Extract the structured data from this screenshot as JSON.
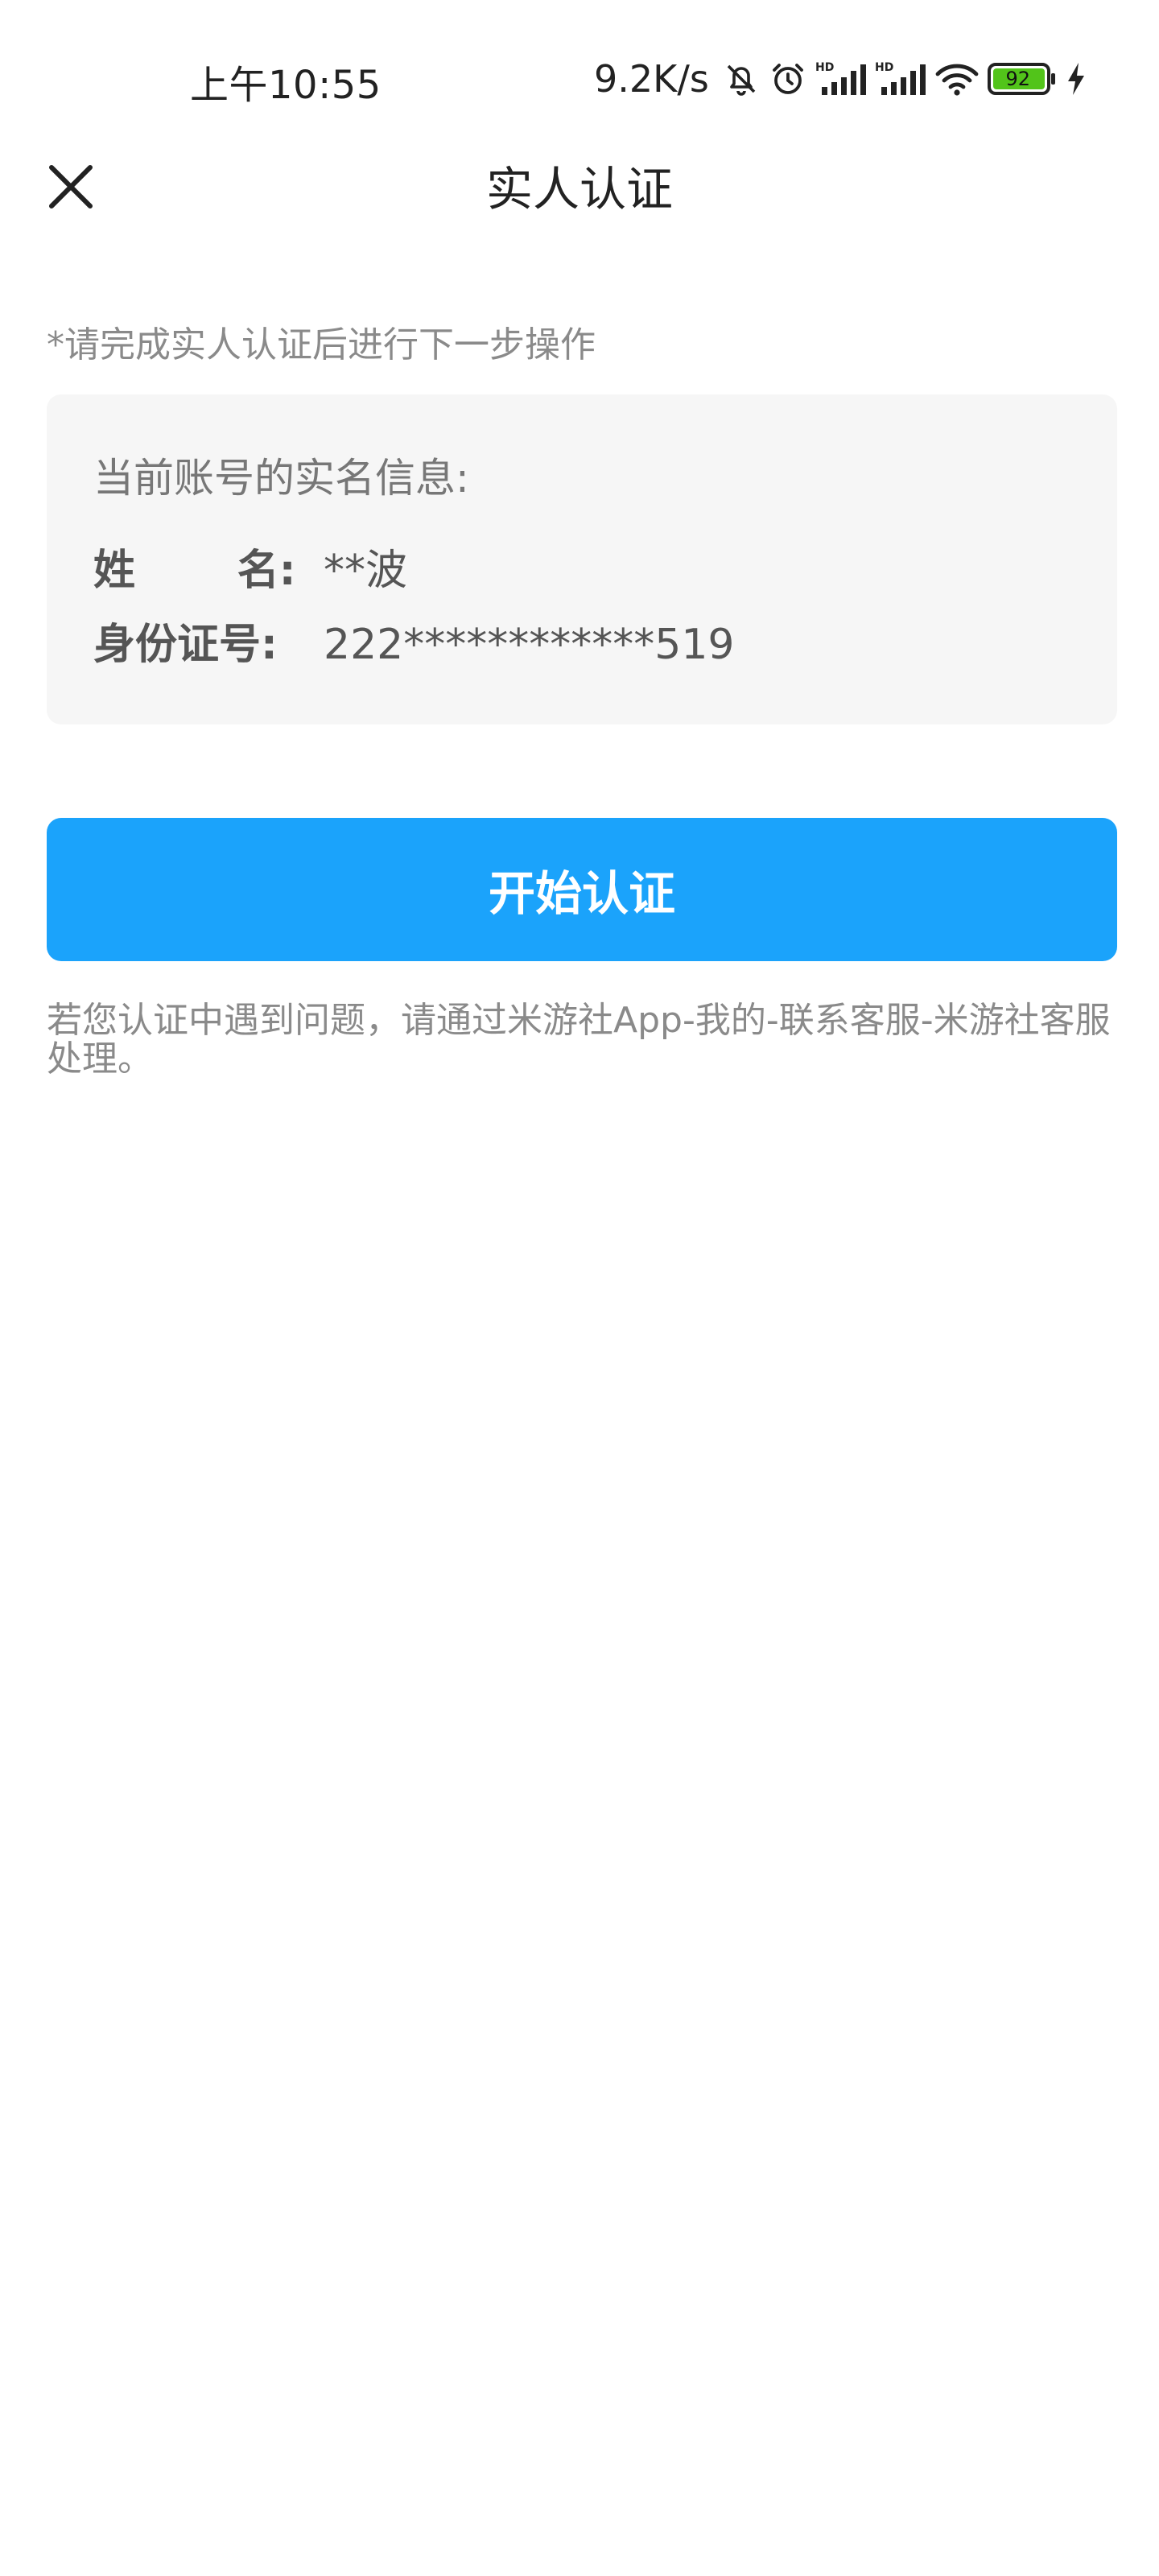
{
  "status_bar": {
    "time": "上午10:55",
    "net_speed": "9.2K/s",
    "battery": "92",
    "icons": [
      "mute-bell-icon",
      "alarm-icon",
      "hd-signal-icon",
      "hd-signal-icon",
      "wifi-icon",
      "battery-icon",
      "charging-icon"
    ],
    "hd_label": "HD",
    "battery_color": "#52c41a"
  },
  "header": {
    "title": "实人认证",
    "close_icon": "close-icon"
  },
  "notice": "*请完成实人认证后进行下一步操作",
  "info_card": {
    "title": "当前账号的实名信息:",
    "name_label": "姓       名:",
    "name_value": "**波",
    "id_label": "身份证号:",
    "id_value": "222************519"
  },
  "start_button": {
    "label": "开始认证",
    "color": "#1ba3fb"
  },
  "help_text": "若您认证中遇到问题，请通过米游社App-我的-联系客服-米游社客服 处理。"
}
